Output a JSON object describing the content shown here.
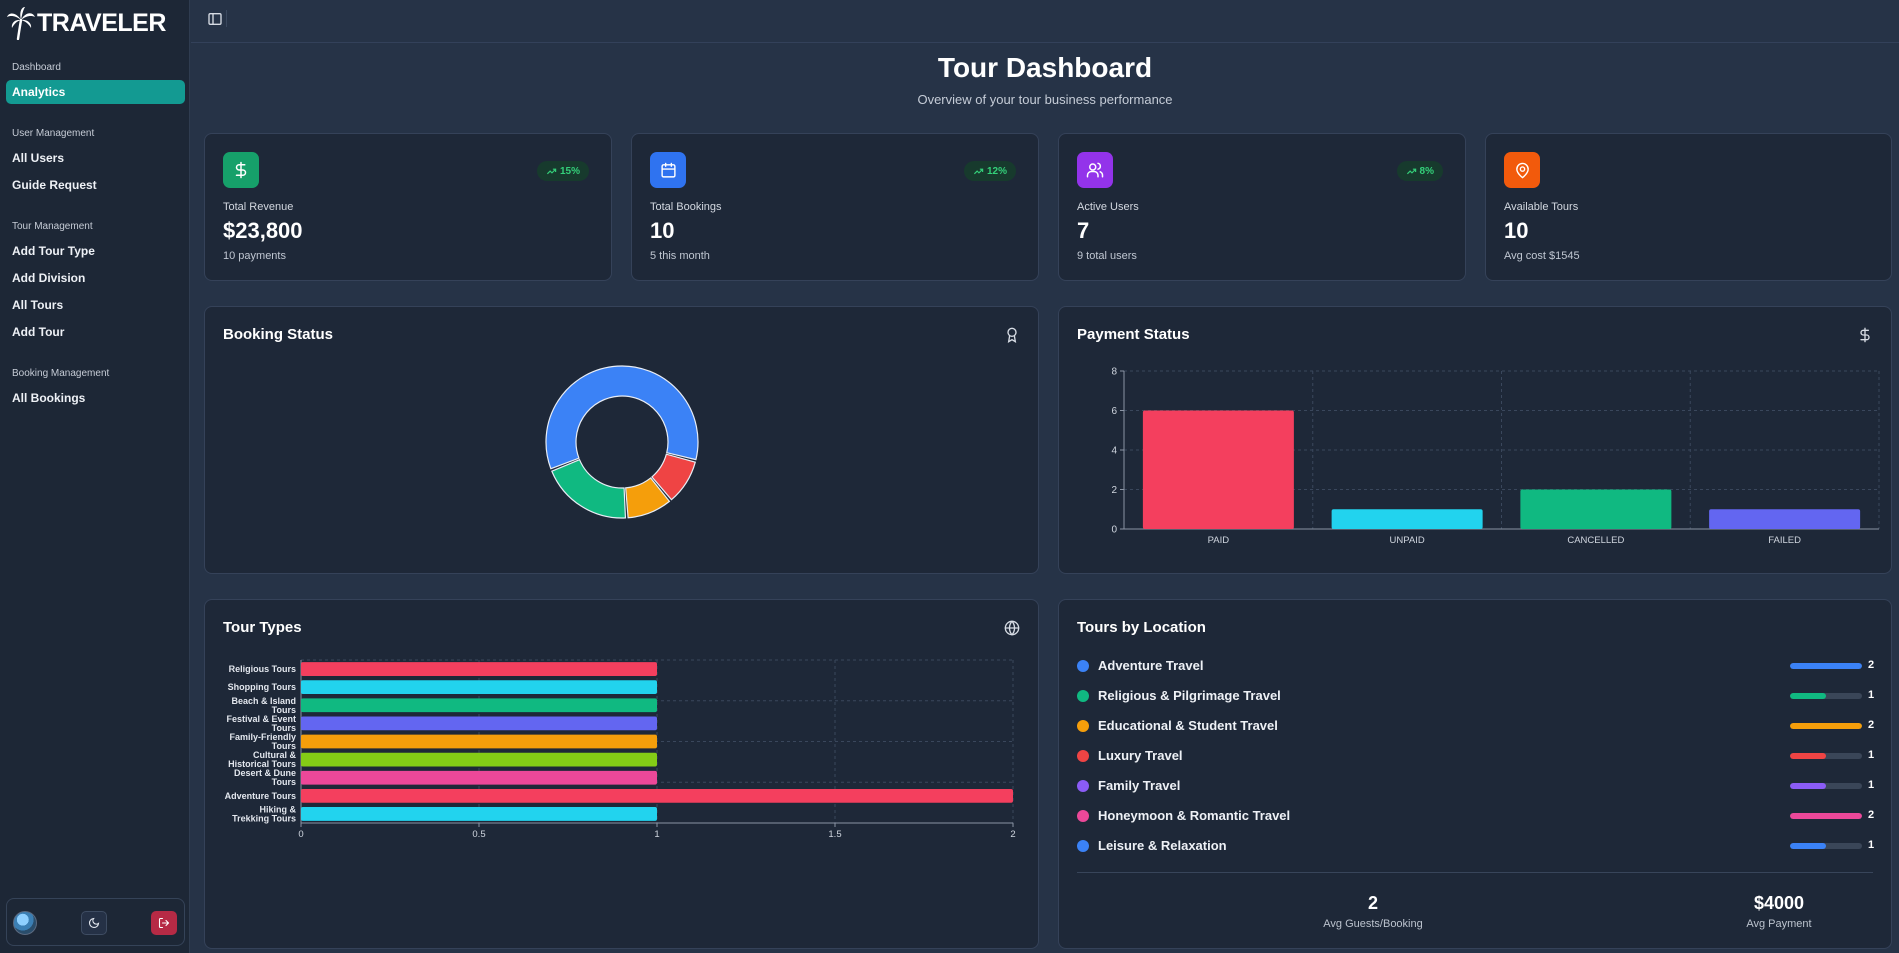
{
  "brand": {
    "name": "TRAVELER"
  },
  "sidebar": {
    "groups": [
      {
        "title": "Dashboard",
        "items": [
          {
            "label": "Analytics",
            "active": true
          }
        ]
      },
      {
        "title": "User Management",
        "items": [
          {
            "label": "All Users"
          },
          {
            "label": "Guide Request"
          }
        ]
      },
      {
        "title": "Tour Management",
        "items": [
          {
            "label": "Add Tour Type"
          },
          {
            "label": "Add Division"
          },
          {
            "label": "All Tours"
          },
          {
            "label": "Add Tour"
          }
        ]
      },
      {
        "title": "Booking Management",
        "items": [
          {
            "label": "All Bookings"
          }
        ]
      }
    ],
    "footer": {
      "theme_icon": "moon-icon",
      "logout_icon": "logout-icon"
    }
  },
  "header": {
    "title": "Tour Dashboard",
    "subtitle": "Overview of your tour business performance"
  },
  "stats": [
    {
      "label": "Total Revenue",
      "value": "$23,800",
      "sub": "10 payments",
      "trend": "15%",
      "icon": "dollar-icon",
      "color": "#16a06a"
    },
    {
      "label": "Total Bookings",
      "value": "10",
      "sub": "5 this month",
      "trend": "12%",
      "icon": "calendar-icon",
      "color": "#2f73f0"
    },
    {
      "label": "Active Users",
      "value": "7",
      "sub": "9 total users",
      "trend": "8%",
      "icon": "users-icon",
      "color": "#9333ea"
    },
    {
      "label": "Available Tours",
      "value": "10",
      "sub": "Avg cost $1545",
      "trend": "",
      "icon": "map-pin-icon",
      "color": "#f25a0c"
    }
  ],
  "booking_status": {
    "title": "Booking Status",
    "icon": "award-icon"
  },
  "payment_status": {
    "title": "Payment Status",
    "icon": "dollar-icon"
  },
  "tour_types": {
    "title": "Tour Types",
    "icon": "globe-icon"
  },
  "tours_by_location": {
    "title": "Tours by Location",
    "items": [
      {
        "name": "Adventure Travel",
        "count": "2",
        "fraction": 1.0,
        "color": "#3b82f6"
      },
      {
        "name": "Religious & Pilgrimage Travel",
        "count": "1",
        "fraction": 0.5,
        "color": "#10b981"
      },
      {
        "name": "Educational & Student Travel",
        "count": "2",
        "fraction": 1.0,
        "color": "#f59e0b"
      },
      {
        "name": "Luxury Travel",
        "count": "1",
        "fraction": 0.5,
        "color": "#ef4444"
      },
      {
        "name": "Family Travel",
        "count": "1",
        "fraction": 0.5,
        "color": "#8b5cf6"
      },
      {
        "name": "Honeymoon & Romantic Travel",
        "count": "2",
        "fraction": 1.0,
        "color": "#ec4899"
      },
      {
        "name": "Leisure & Relaxation",
        "count": "1",
        "fraction": 0.5,
        "color": "#3b82f6"
      }
    ],
    "summary": [
      {
        "value": "2",
        "label": "Avg Guests/Booking"
      },
      {
        "value": "$4000",
        "label": "Avg Payment"
      }
    ]
  },
  "chart_data": [
    {
      "type": "pie",
      "variant": "donut",
      "labels": [],
      "values": [
        6,
        1,
        1,
        2
      ],
      "colors": [
        "#3b82f6",
        "#ef4444",
        "#f59e0b",
        "#10b981"
      ]
    },
    {
      "type": "bar",
      "categories": [
        "PAID",
        "UNPAID",
        "CANCELLED",
        "FAILED"
      ],
      "values": [
        6,
        1,
        2,
        1
      ],
      "colors": [
        "#f43f5e",
        "#22d3ee",
        "#10b981",
        "#6366f1"
      ],
      "ylim": [
        0,
        8
      ],
      "yticks": [
        "0",
        "2",
        "4",
        "6",
        "8"
      ],
      "grid": true
    },
    {
      "type": "bar",
      "orientation": "horizontal",
      "categories": [
        [
          "Religious Tours"
        ],
        [
          "Shopping Tours"
        ],
        [
          "Beach & Island",
          "Tours"
        ],
        [
          "Festival & Event",
          "Tours"
        ],
        [
          "Family-Friendly",
          "Tours"
        ],
        [
          "Cultural &",
          "Historical Tours"
        ],
        [
          "Desert & Dune",
          "Tours"
        ],
        [
          "Adventure Tours"
        ],
        [
          "Hiking &",
          "Trekking Tours"
        ]
      ],
      "values": [
        1,
        1,
        1,
        1,
        1,
        1,
        1,
        2,
        1
      ],
      "colors": [
        "#f43f5e",
        "#22d3ee",
        "#10b981",
        "#6366f1",
        "#f59e0b",
        "#84cc16",
        "#ec4899",
        "#f43f5e",
        "#22d3ee"
      ],
      "xlim": [
        0,
        2
      ],
      "xticks": [
        "0",
        "0.5",
        "1",
        "1.5",
        "2"
      ],
      "grid": true
    }
  ]
}
